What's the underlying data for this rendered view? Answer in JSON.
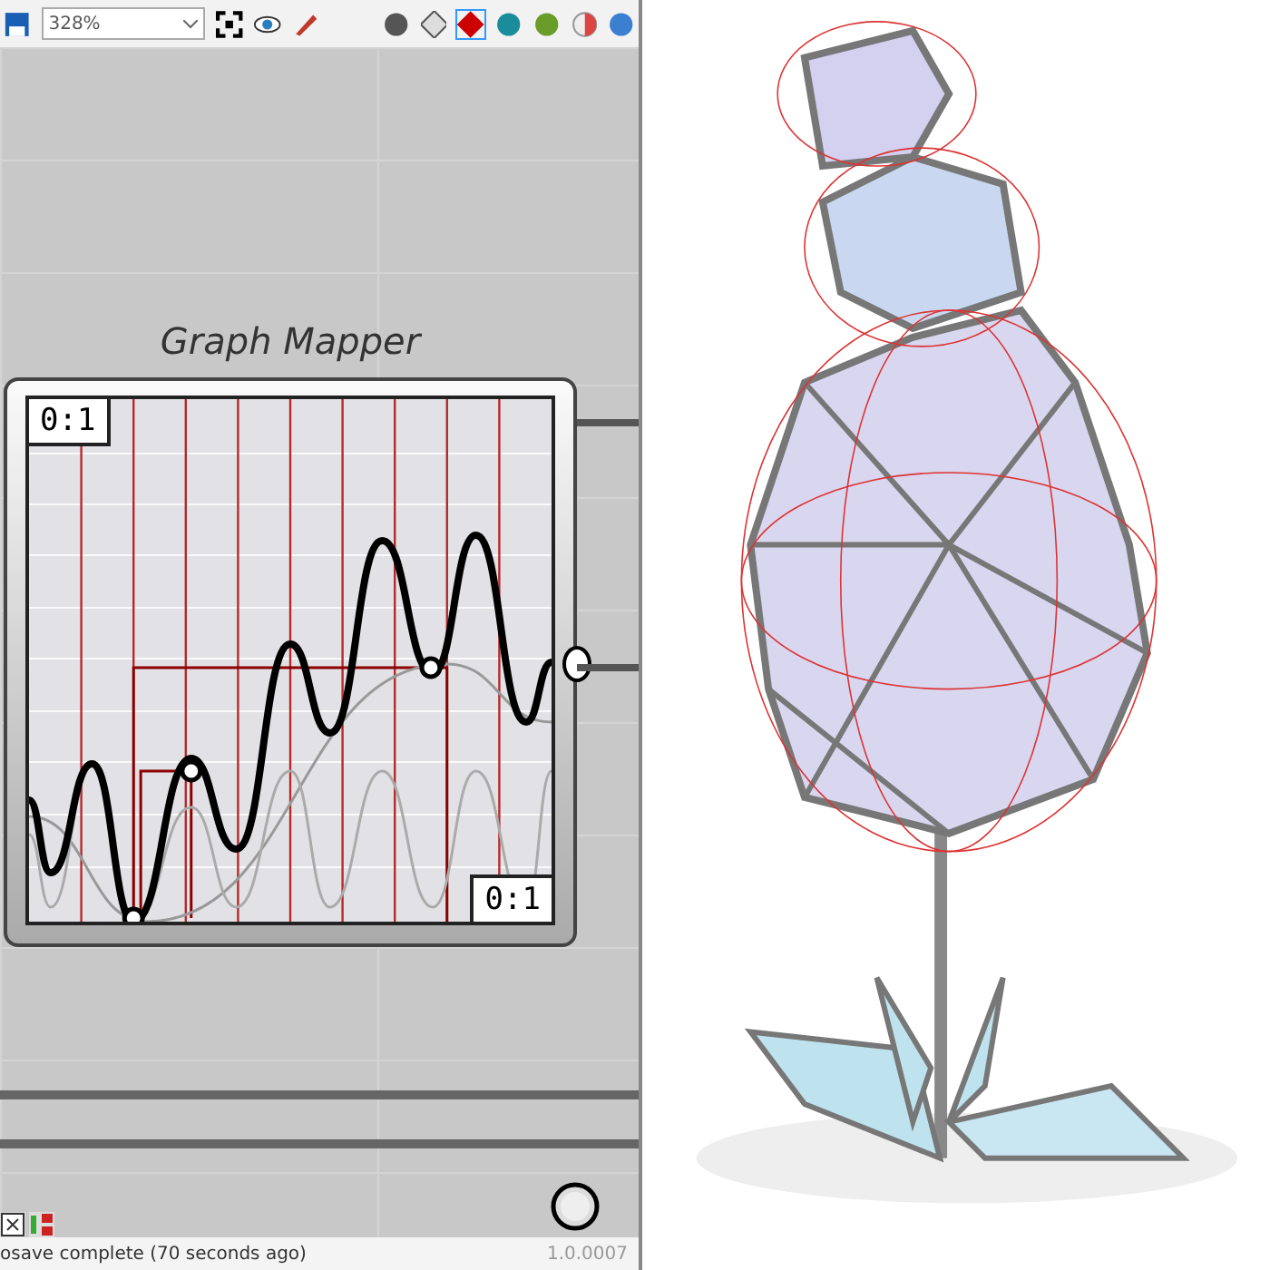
{
  "toolbar": {
    "zoom_value": "328%"
  },
  "component": {
    "title": "Graph Mapper",
    "input_range": "0:1",
    "output_range": "0:1"
  },
  "status_bar": {
    "message": "osave complete (70 seconds ago)",
    "version": "1.0.0007"
  }
}
